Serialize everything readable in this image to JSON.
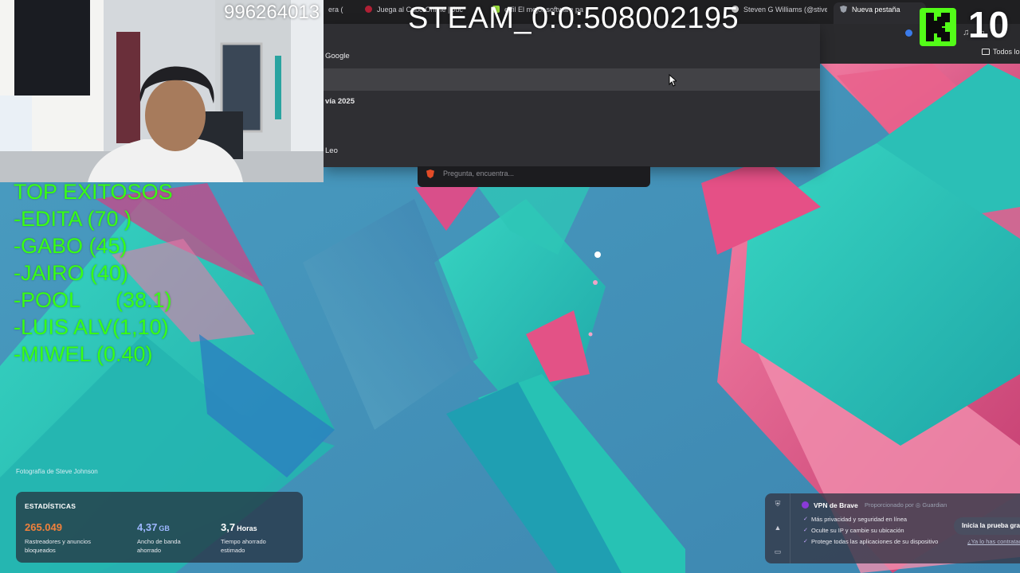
{
  "overlay": {
    "stream_number": "996264013",
    "steam_id": "STEAM_0:0:508002195",
    "kick_count": "10",
    "top_list": [
      "TOP EXITOSOS",
      "-EDITA (70 )",
      "-GABO (45)",
      "-JAIRO (40)",
      "-POOL      (38.1)",
      "-LUIS ALV(1,10)",
      "-MIWEL (0.40)"
    ]
  },
  "browser": {
    "tabs": [
      {
        "label": "era (",
        "icon": "page-icon"
      },
      {
        "label": "Juega al Cubo Online | Juc",
        "icon": "game-icon"
      },
      {
        "label": "erfil El mejor software pa",
        "icon": "page-icon"
      },
      {
        "label": "Steven G Williams (@stiven",
        "icon": "profile-icon"
      },
      {
        "label": "Nueva pestaña",
        "icon": "shield-icon"
      }
    ],
    "bookmarks_all": "Todos los",
    "suggestions": [
      {
        "text": "Google",
        "bold": false
      },
      {
        "text": "",
        "bold": false
      },
      {
        "text": "vía 2025",
        "bold": true
      },
      {
        "text": "",
        "bold": false
      },
      {
        "text": "Leo",
        "bold": false
      }
    ],
    "search_placeholder": "Pregunta, encuentra..."
  },
  "page": {
    "photo_credit": "Fotografía de Steve Johnson"
  },
  "stats": {
    "title": "ESTADÍSTICAS",
    "items": [
      {
        "value": "265.049",
        "unit": "",
        "desc": "Rastreadores y anuncios bloqueados",
        "color": "#f0813c"
      },
      {
        "value": "4,37",
        "unit": "GB",
        "desc": "Ancho de banda ahorrado",
        "color": "#9db7ff"
      },
      {
        "value": "3,7",
        "unit": "Horas",
        "desc": "Tiempo ahorrado estimado",
        "color": "#ffffff"
      }
    ]
  },
  "vpn": {
    "title": "VPN de Brave",
    "provided_by": "Proporcionado por ◎ Guardian",
    "bullets": [
      "Más privacidad y seguridad en línea",
      "Oculte su IP y cambie su ubicación",
      "Protege todas las aplicaciones de su dispositivo"
    ],
    "cta": "Inicia la prueba gra",
    "link": "¿Ya lo has contratado?"
  },
  "colors": {
    "overlay_green": "#39ff14",
    "kick_green": "#53fc18",
    "bg_teal": "#2fc7b8",
    "bg_blue": "#3f8fb4",
    "bg_pink": "#e2537f"
  }
}
